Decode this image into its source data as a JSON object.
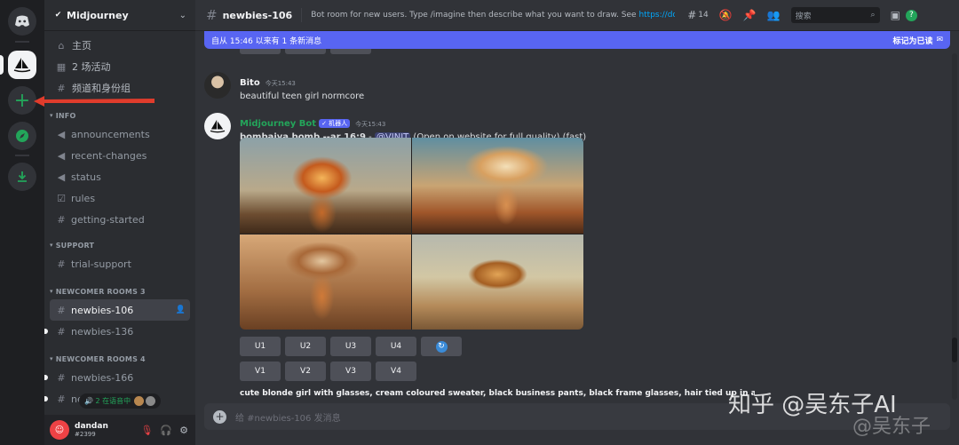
{
  "guild": {
    "name": "Midjourney"
  },
  "top_items": [
    {
      "label": "主页",
      "icon": "home-icon"
    },
    {
      "label": "2 场活动",
      "icon": "calendar-icon"
    },
    {
      "label": "频道和身份组",
      "icon": "channels-roles-icon"
    }
  ],
  "categories": {
    "info": "INFO",
    "support": "SUPPORT",
    "newcomer3": "NEWCOMER ROOMS 3",
    "newcomer4": "NEWCOMER ROOMS 4"
  },
  "channels": {
    "announcements": "announcements",
    "recent_changes": "recent-changes",
    "status": "status",
    "rules": "rules",
    "getting_started": "getting-started",
    "trial_support": "trial-support",
    "newbies_106": "newbies-106",
    "newbies_136": "newbies-136",
    "newbies_166": "newbies-166",
    "newbies_partial": "newbie"
  },
  "voice_pill": {
    "text": "2 在语音中"
  },
  "user": {
    "name": "dandan",
    "tag": "#2399"
  },
  "topbar": {
    "channel": "newbies-106",
    "topic": "Bot room for new users. Type /imagine then describe what you want to draw. See ",
    "topic_link": "https://docs.midjourney.com/",
    "thread_count": "14",
    "search_placeholder": "搜索"
  },
  "new_messages_bar": {
    "left": "自从 15:46 以来有 1 条新消息",
    "right": "标记为已读"
  },
  "messages": [
    {
      "author": "Bito",
      "timestamp": "今天15:43",
      "text": "beautiful teen girl normcore"
    },
    {
      "author": "Midjourney Bot",
      "badge": "✓ 机器人",
      "timestamp": "今天15:43",
      "prompt": "bombaiya bomb --ar 16:9",
      "dash": " - ",
      "mention": "@VINIT",
      "suffix": " (Open on website for full quality) (fast)"
    }
  ],
  "upscale_buttons": [
    "U1",
    "U2",
    "U3",
    "U4"
  ],
  "variation_buttons": [
    "V1",
    "V2",
    "V3",
    "V4"
  ],
  "trailing_text": "cute blonde girl with glasses, cream coloured sweater, black business pants, black frame glasses, hair tied up in a bun, on stone, wearing eyeglasses",
  "composer": {
    "placeholder": "给 #newbies-106 发消息"
  },
  "watermark": {
    "main": "知乎 @吴东子AI",
    "shadow": "@吴东子"
  },
  "colors": {
    "accent": "#5865f2",
    "bot_name": "#23a55a",
    "link": "#00a8fc",
    "muted": "#ed4245"
  }
}
